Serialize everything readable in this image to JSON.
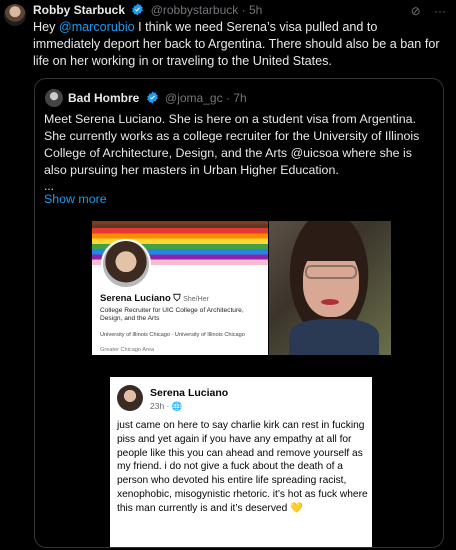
{
  "post": {
    "author_name": "Robby Starbuck",
    "handle": "@robbystarbuck",
    "separator": "·",
    "time": "5h",
    "text_before_mention": "Hey ",
    "mention": "@marcorubio",
    "text_after_mention": " I think we need Serena’s visa pulled and to immediately deport her back to Argentina. There should also be a ban for life on her working in or traveling to the United States."
  },
  "quote": {
    "author_name": "Bad Hombre",
    "handle": "@joma_gc",
    "separator": "·",
    "time": "7h",
    "text": "Meet Serena Luciano. She is here on a student visa from Argentina. She currently works as a college recruiter for the University of Illinois College of Architecture, Design, and the Arts @uicsoa where she is also pursuing her masters in Urban Higher Education.",
    "ellipsis": "...",
    "show_more": "Show more"
  },
  "linkedin_card": {
    "name": "Serena Luciano",
    "pronouns": "She/Her",
    "headline": "College Recruiter for UIC College of Architecture, Design, and the Arts",
    "education": "University of Illinois Chicago · University of Illinois Chicago",
    "location": "Greater Chicago Area"
  },
  "facebook_post": {
    "name": "Serena Luciano",
    "meta": "23h · ",
    "text": "just came on here to say charlie kirk can rest in fucking piss and yet again if you have any empathy at all for people like this you can ahead and remove yourself as my friend. i do not give a fuck about the death of a person who devoted his entire life spreading racist, xenophobic, misogynistic rhetoric. it’s hot as fuck where this man currently is and it’s deserved",
    "emoji": "💛"
  },
  "icons": [
    "verified-badge-icon",
    "grok-icon",
    "more-icon",
    "globe-icon",
    "heart-icon"
  ],
  "colors": {
    "background": "#000000",
    "text": "#e7e9ea",
    "muted": "#71767b",
    "accent": "#1d9bf0"
  }
}
